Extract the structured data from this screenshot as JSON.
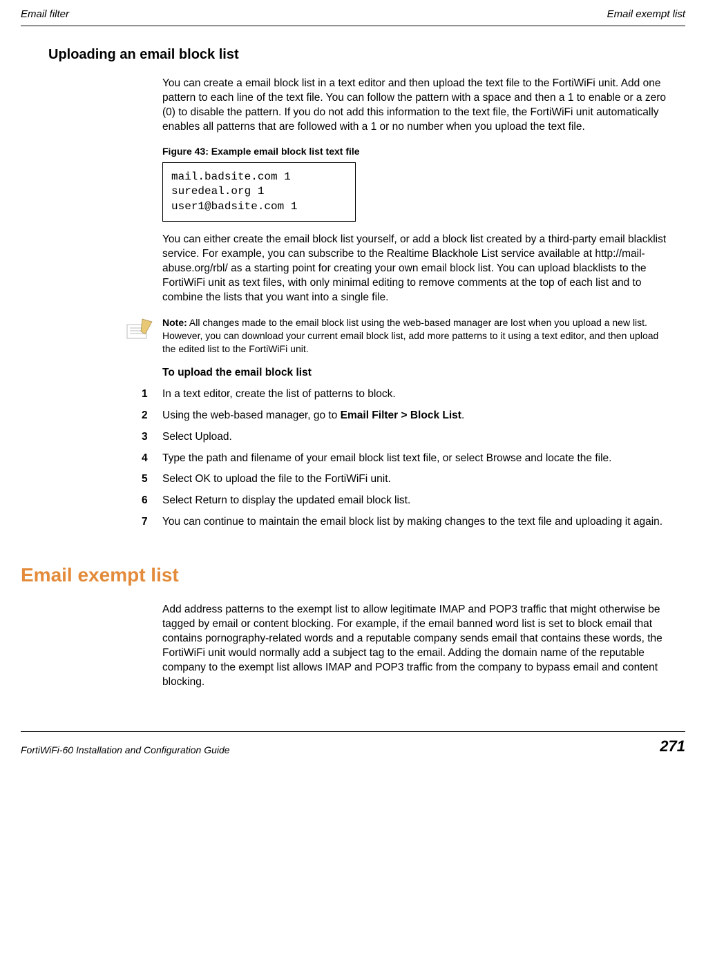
{
  "header": {
    "left": "Email filter",
    "right": "Email exempt list"
  },
  "section1": {
    "heading": "Uploading an email block list",
    "para1": "You can create a email block list in a text editor and then upload the text file to the FortiWiFi unit. Add one pattern to each line of the text file. You can follow the pattern with a space and then a 1 to enable or a zero (0) to disable the pattern. If you do not add this information to the text file, the FortiWiFi unit automatically enables all patterns that are followed with a 1 or no number when you upload the text file.",
    "figcaption": "Figure 43: Example email block list text file",
    "code": "mail.badsite.com 1\nsuredeal.org 1\nuser1@badsite.com 1",
    "para2": "You can either create the email block list yourself, or add a block list created by a third-party email blacklist service. For example, you can subscribe to the Realtime Blackhole List service available at http://mail-abuse.org/rbl/ as a starting point for creating your own email block list. You can upload blacklists to the FortiWiFi unit as text files, with only minimal editing to remove comments at the top of each list and to combine the lists that you want into a single file.",
    "note": {
      "label": "Note:",
      "text": " All changes made to the email block list using the web-based manager are lost when you upload a new list. However, you can download your current email block list, add more patterns to it using a text editor, and then upload the edited list to the FortiWiFi unit."
    },
    "procedure": {
      "title": "To upload the email block list",
      "steps": [
        "In a text editor, create the list of patterns to block.",
        {
          "pre": "Using the web-based manager, go to ",
          "bold": "Email Filter > Block List",
          "post": "."
        },
        "Select Upload.",
        "Type the path and filename of your email block list text file, or select Browse and locate the file.",
        "Select OK to upload the file to the FortiWiFi unit.",
        "Select Return to display the updated email block list.",
        "You can continue to maintain the email block list by making changes to the text file and uploading it again."
      ]
    }
  },
  "section2": {
    "heading": "Email exempt list",
    "para": "Add address patterns to the exempt list to allow legitimate IMAP and POP3 traffic that might otherwise be tagged by email or content blocking. For example, if the email banned word list is set to block email that contains pornography-related words and a reputable company sends email that contains these words, the FortiWiFi unit would normally add a subject tag to the email. Adding the domain name of the reputable company to the exempt list allows IMAP and POP3 traffic from the company to bypass email and content blocking."
  },
  "footer": {
    "left": "FortiWiFi-60 Installation and Configuration Guide",
    "right": "271"
  }
}
